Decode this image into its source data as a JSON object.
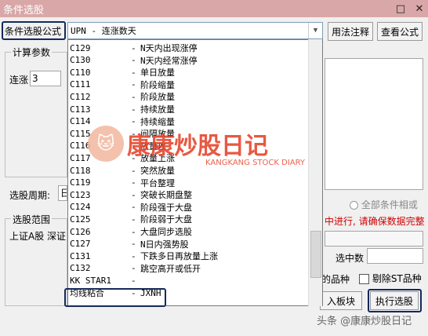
{
  "window": {
    "title": "条件选股",
    "max_btn": "□",
    "close_btn": "✕"
  },
  "formula": {
    "label": "条件选股公式",
    "selected": "UPN      - 连涨数天",
    "arrow": "▼"
  },
  "buttons": {
    "usage": "用法注释",
    "view": "查看公式",
    "load": "入板块",
    "execute": "执行选股"
  },
  "params": {
    "title": "计算参数",
    "label": "连涨",
    "value": "3"
  },
  "period": {
    "label": "选股周期:",
    "value": "日"
  },
  "range": {
    "title": "选股范围",
    "text": "上证A股 深证"
  },
  "dropdown": {
    "items": [
      {
        "code": "C129",
        "sep": "-",
        "name": "N天内出现涨停"
      },
      {
        "code": "C130",
        "sep": "-",
        "name": "N天内经常涨停"
      },
      {
        "code": "C110",
        "sep": "-",
        "name": "单日放量"
      },
      {
        "code": "C111",
        "sep": "-",
        "name": "阶段缩量"
      },
      {
        "code": "C112",
        "sep": "-",
        "name": "阶段放量"
      },
      {
        "code": "C113",
        "sep": "-",
        "name": "持续放量"
      },
      {
        "code": "C114",
        "sep": "-",
        "name": "持续缩量"
      },
      {
        "code": "C115",
        "sep": "-",
        "name": "间隔放量"
      },
      {
        "code": "C116",
        "sep": "-",
        "name": "放量攻"
      },
      {
        "code": "C117",
        "sep": "-",
        "name": "放量上涨"
      },
      {
        "code": "C118",
        "sep": "-",
        "name": "突然放量"
      },
      {
        "code": "C119",
        "sep": "-",
        "name": "平台整理"
      },
      {
        "code": "C123",
        "sep": "-",
        "name": "突破长期盘整"
      },
      {
        "code": "C124",
        "sep": "-",
        "name": "阶段强于大盘"
      },
      {
        "code": "C125",
        "sep": "-",
        "name": "阶段弱于大盘"
      },
      {
        "code": "C126",
        "sep": "-",
        "name": "大盘同步选股"
      },
      {
        "code": "C127",
        "sep": "-",
        "name": "N日内强势股"
      },
      {
        "code": "C131",
        "sep": "-",
        "name": "下跌多日再放量上涨"
      },
      {
        "code": "C132",
        "sep": "-",
        "name": "跳空高开或低开"
      },
      {
        "code": "KK STAR1",
        "sep": "-",
        "name": ""
      },
      {
        "code": "均线粘合",
        "sep": "-",
        "name": "JXNH"
      }
    ]
  },
  "right": {
    "all_conditions": "全部条件相或",
    "warning": "中进行, 请确保数据完整",
    "selected_count": "选中数",
    "variety": "的品种",
    "exclude_st": "剔除ST品种"
  },
  "watermark": {
    "brand": "康康炒股日记",
    "sub": "KANGKANG STOCK DIARY",
    "icon": "🐱"
  },
  "credit": "头条 @康康炒股日记",
  "colors": {
    "titlebar": "#d9a7a7",
    "highlight": "#132a5c",
    "warning": "#d00000",
    "watermark": "#e6462e"
  }
}
